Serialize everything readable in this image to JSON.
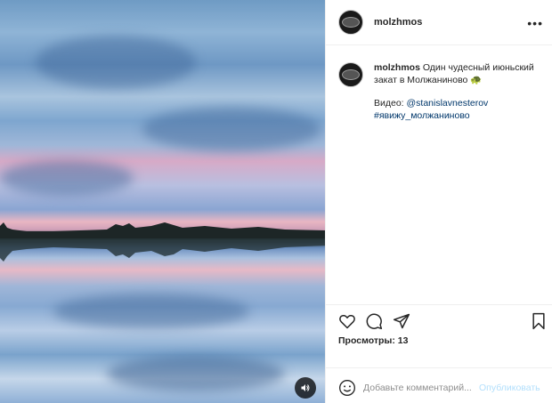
{
  "post": {
    "username": "molzhmos",
    "caption": {
      "username": "molzhmos",
      "text": "Один чудесный июньский закат в Молжаниново",
      "emoji": "🐢",
      "video_prefix": "Видео: ",
      "mention": "@stanislavnesterov",
      "hashtag": "#явижу_молжаниново"
    },
    "views_label": "Просмотры: 13",
    "comment": {
      "placeholder": "Добавьте комментарий...",
      "publish_label": "Опубликовать"
    }
  },
  "icons": {
    "more": "more-horizontal-icon",
    "like": "heart-icon",
    "comment": "comment-bubble-icon",
    "share": "paper-plane-icon",
    "save": "bookmark-icon",
    "emoji": "smiley-icon",
    "sound": "speaker-icon"
  },
  "colors": {
    "link": "#00376b",
    "publish_disabled": "#b2dffc",
    "text": "#262626",
    "muted": "#8e8e8e"
  }
}
